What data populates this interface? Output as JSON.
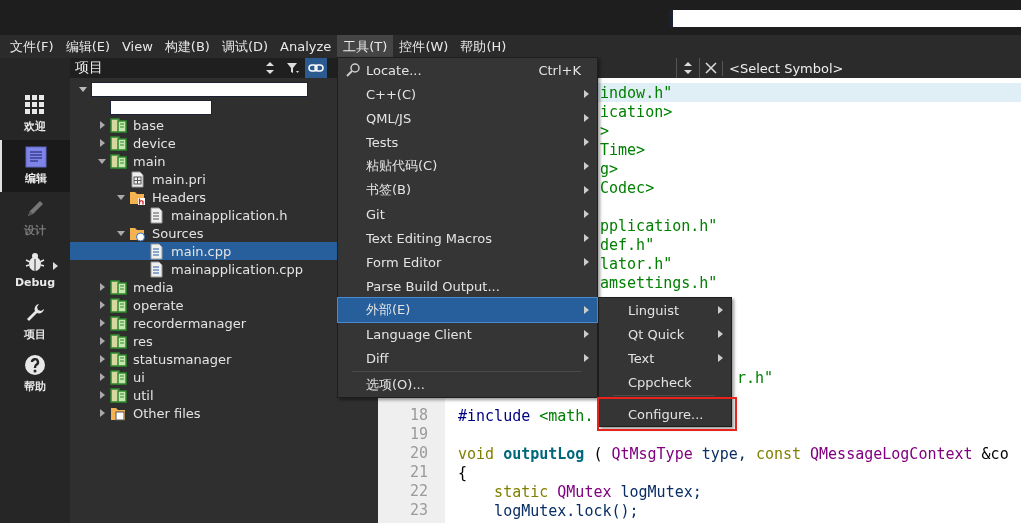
{
  "menubar": [
    {
      "label": "文件(F)",
      "selected": false
    },
    {
      "label": "编辑(E)",
      "selected": false
    },
    {
      "label": "View",
      "selected": false
    },
    {
      "label": "构建(B)",
      "selected": false
    },
    {
      "label": "调试(D)",
      "selected": false
    },
    {
      "label": "Analyze",
      "selected": false
    },
    {
      "label": "工具(T)",
      "selected": true
    },
    {
      "label": "控件(W)",
      "selected": false
    },
    {
      "label": "帮助(H)",
      "selected": false
    }
  ],
  "modes": [
    {
      "kind": "welcome",
      "label": "欢迎",
      "selected": false,
      "disabled": false
    },
    {
      "kind": "edit",
      "label": "编辑",
      "selected": true,
      "disabled": false
    },
    {
      "kind": "design",
      "label": "设计",
      "selected": false,
      "disabled": true
    },
    {
      "kind": "debug",
      "label": "Debug",
      "selected": false,
      "disabled": false
    },
    {
      "kind": "projects",
      "label": "项目",
      "selected": false,
      "disabled": false
    },
    {
      "kind": "help",
      "label": "帮助",
      "selected": false,
      "disabled": false
    }
  ],
  "project_panel": {
    "title": "项目",
    "sync_on": true,
    "tree": [
      {
        "kind": "redacted",
        "expanded": true,
        "selected": false,
        "children": [
          {
            "kind": "redacted",
            "selected": false
          },
          {
            "kind": "project",
            "label": "base",
            "expanded": false,
            "selected": false
          },
          {
            "kind": "project",
            "label": "device",
            "expanded": false,
            "selected": false
          },
          {
            "kind": "project",
            "label": "main",
            "expanded": true,
            "selected": false,
            "children": [
              {
                "kind": "pri",
                "label": "main.pri",
                "selected": false
              },
              {
                "kind": "headers",
                "label": "Headers",
                "expanded": true,
                "selected": false,
                "children": [
                  {
                    "kind": "header",
                    "label": "mainapplication.h",
                    "selected": false
                  }
                ]
              },
              {
                "kind": "sources",
                "label": "Sources",
                "expanded": true,
                "selected": false,
                "children": [
                  {
                    "kind": "source",
                    "label": "main.cpp",
                    "selected": true
                  },
                  {
                    "kind": "source",
                    "label": "mainapplication.cpp",
                    "selected": false
                  }
                ]
              }
            ]
          },
          {
            "kind": "project",
            "label": "media",
            "expanded": false,
            "selected": false
          },
          {
            "kind": "project",
            "label": "operate",
            "expanded": false,
            "selected": false
          },
          {
            "kind": "project",
            "label": "recordermanager",
            "expanded": false,
            "selected": false
          },
          {
            "kind": "project",
            "label": "res",
            "expanded": false,
            "selected": false
          },
          {
            "kind": "project",
            "label": "statusmanager",
            "expanded": false,
            "selected": false
          },
          {
            "kind": "project",
            "label": "ui",
            "expanded": false,
            "selected": false
          },
          {
            "kind": "project",
            "label": "util",
            "expanded": false,
            "selected": false
          },
          {
            "kind": "other",
            "label": "Other files",
            "expanded": false,
            "selected": false
          }
        ]
      }
    ]
  },
  "editor": {
    "symbol": "<Select Symbol>",
    "lines": [
      {
        "kind": "behind-menu",
        "current": true,
        "tokens": [
          {
            "text": "indow.h\"",
            "color": "#008000"
          }
        ]
      },
      {
        "kind": "behind-menu",
        "current": false,
        "tokens": [
          {
            "text": "ication>",
            "color": "#008000"
          }
        ]
      },
      {
        "kind": "behind-menu",
        "current": false,
        "tokens": [
          {
            "text": ">",
            "color": "#008000"
          }
        ]
      },
      {
        "kind": "behind-menu",
        "current": false,
        "tokens": [
          {
            "text": "Time>",
            "color": "#008000"
          }
        ]
      },
      {
        "kind": "behind-menu",
        "current": false,
        "tokens": [
          {
            "text": "g>",
            "color": "#008000"
          }
        ]
      },
      {
        "kind": "behind-menu",
        "current": false,
        "tokens": [
          {
            "text": "Codec>",
            "color": "#008000"
          }
        ]
      },
      {
        "kind": "behind-menu",
        "current": false
      },
      {
        "kind": "behind-menu",
        "current": false,
        "tokens": [
          {
            "text": "pplication.h\"",
            "color": "#008000"
          }
        ]
      },
      {
        "kind": "behind-menu",
        "current": false,
        "tokens": [
          {
            "text": "def.h\"",
            "color": "#008000"
          }
        ]
      },
      {
        "kind": "behind-menu",
        "current": false,
        "tokens": [
          {
            "text": "lator.h\"",
            "color": "#008000"
          }
        ]
      },
      {
        "kind": "behind-menu",
        "current": false,
        "tokens": [
          {
            "text": "amsettings.h\"",
            "color": "#008000"
          }
        ]
      },
      {
        "kind": "behind-menu",
        "current": false
      },
      {
        "kind": "behind-menu",
        "current": false
      },
      {
        "kind": "behind-menu",
        "current": false
      },
      {
        "kind": "behind-menu",
        "current": false
      },
      {
        "kind": "behind-submenu",
        "current": false,
        "tokens": [
          {
            "text": "r.h\"",
            "color": "#008000"
          }
        ]
      },
      {
        "kind": "full",
        "current": false
      },
      {
        "kind": "full",
        "number": "18",
        "current": false,
        "tokens": [
          {
            "text": "#include",
            "color": "#000080"
          },
          {
            "text": "<math.",
            "color": "#008000"
          }
        ]
      },
      {
        "kind": "full",
        "number": "19",
        "current": false
      },
      {
        "kind": "full",
        "number": "20",
        "current": false,
        "tokens": [
          {
            "text": "void",
            "color": "#808000"
          },
          {
            "text": "outputLog",
            "color": "#00677c",
            "bold": true
          },
          {
            "text": "(",
            "color": "#000000"
          },
          {
            "text": "QtMsgType",
            "color": "#800080"
          },
          {
            "text": "type,",
            "color": "#092e64"
          },
          {
            "text": "const",
            "color": "#808000"
          },
          {
            "text": "QMessageLogContext",
            "color": "#800080"
          },
          {
            "text": "&co",
            "color": "#000000"
          }
        ]
      },
      {
        "kind": "full",
        "number": "21",
        "current": false,
        "tokens": [
          {
            "text": "{",
            "color": "#000000"
          }
        ]
      },
      {
        "kind": "full",
        "number": "22",
        "current": false,
        "tokens": [
          {
            "text": "    static",
            "color": "#808000"
          },
          {
            "text": "QMutex",
            "color": "#800080"
          },
          {
            "text": "logMutex;",
            "color": "#092e64"
          }
        ]
      },
      {
        "kind": "full",
        "number": "23",
        "current": false,
        "tokens": [
          {
            "text": "    logMutex.lock();",
            "color": "#092e64"
          }
        ]
      }
    ]
  },
  "tools_menu": [
    {
      "kind": "search",
      "label": "Locate...",
      "shortcut": "Ctrl+K",
      "selected": false
    },
    {
      "kind": "submenu",
      "label": "C++(C)",
      "selected": false
    },
    {
      "kind": "submenu",
      "label": "QML/JS",
      "selected": false
    },
    {
      "kind": "submenu",
      "label": "Tests",
      "selected": false
    },
    {
      "kind": "submenu",
      "label": "粘贴代码(C)",
      "selected": false
    },
    {
      "kind": "submenu",
      "label": "书签(B)",
      "selected": false
    },
    {
      "kind": "submenu",
      "label": "Git",
      "selected": false
    },
    {
      "kind": "submenu",
      "label": "Text Editing Macros",
      "selected": false
    },
    {
      "kind": "submenu",
      "label": "Form Editor",
      "selected": false
    },
    {
      "kind": "action",
      "label": "Parse Build Output...",
      "selected": false
    },
    {
      "kind": "submenu",
      "label": "外部(E)",
      "selected": true
    },
    {
      "kind": "submenu",
      "label": "Language Client",
      "selected": false
    },
    {
      "kind": "submenu",
      "label": "Diff",
      "selected": false
    },
    {
      "kind": "separator"
    },
    {
      "kind": "action",
      "label": "选项(O)...",
      "selected": false
    }
  ],
  "external_menu": [
    {
      "kind": "submenu",
      "label": "Linguist",
      "selected": false
    },
    {
      "kind": "submenu",
      "label": "Qt Quick",
      "selected": false
    },
    {
      "kind": "submenu",
      "label": "Text",
      "selected": false
    },
    {
      "kind": "action",
      "label": "Cppcheck",
      "selected": false
    },
    {
      "kind": "separator"
    },
    {
      "kind": "action",
      "label": "Configure...",
      "selected": false,
      "highlighted": true
    }
  ]
}
